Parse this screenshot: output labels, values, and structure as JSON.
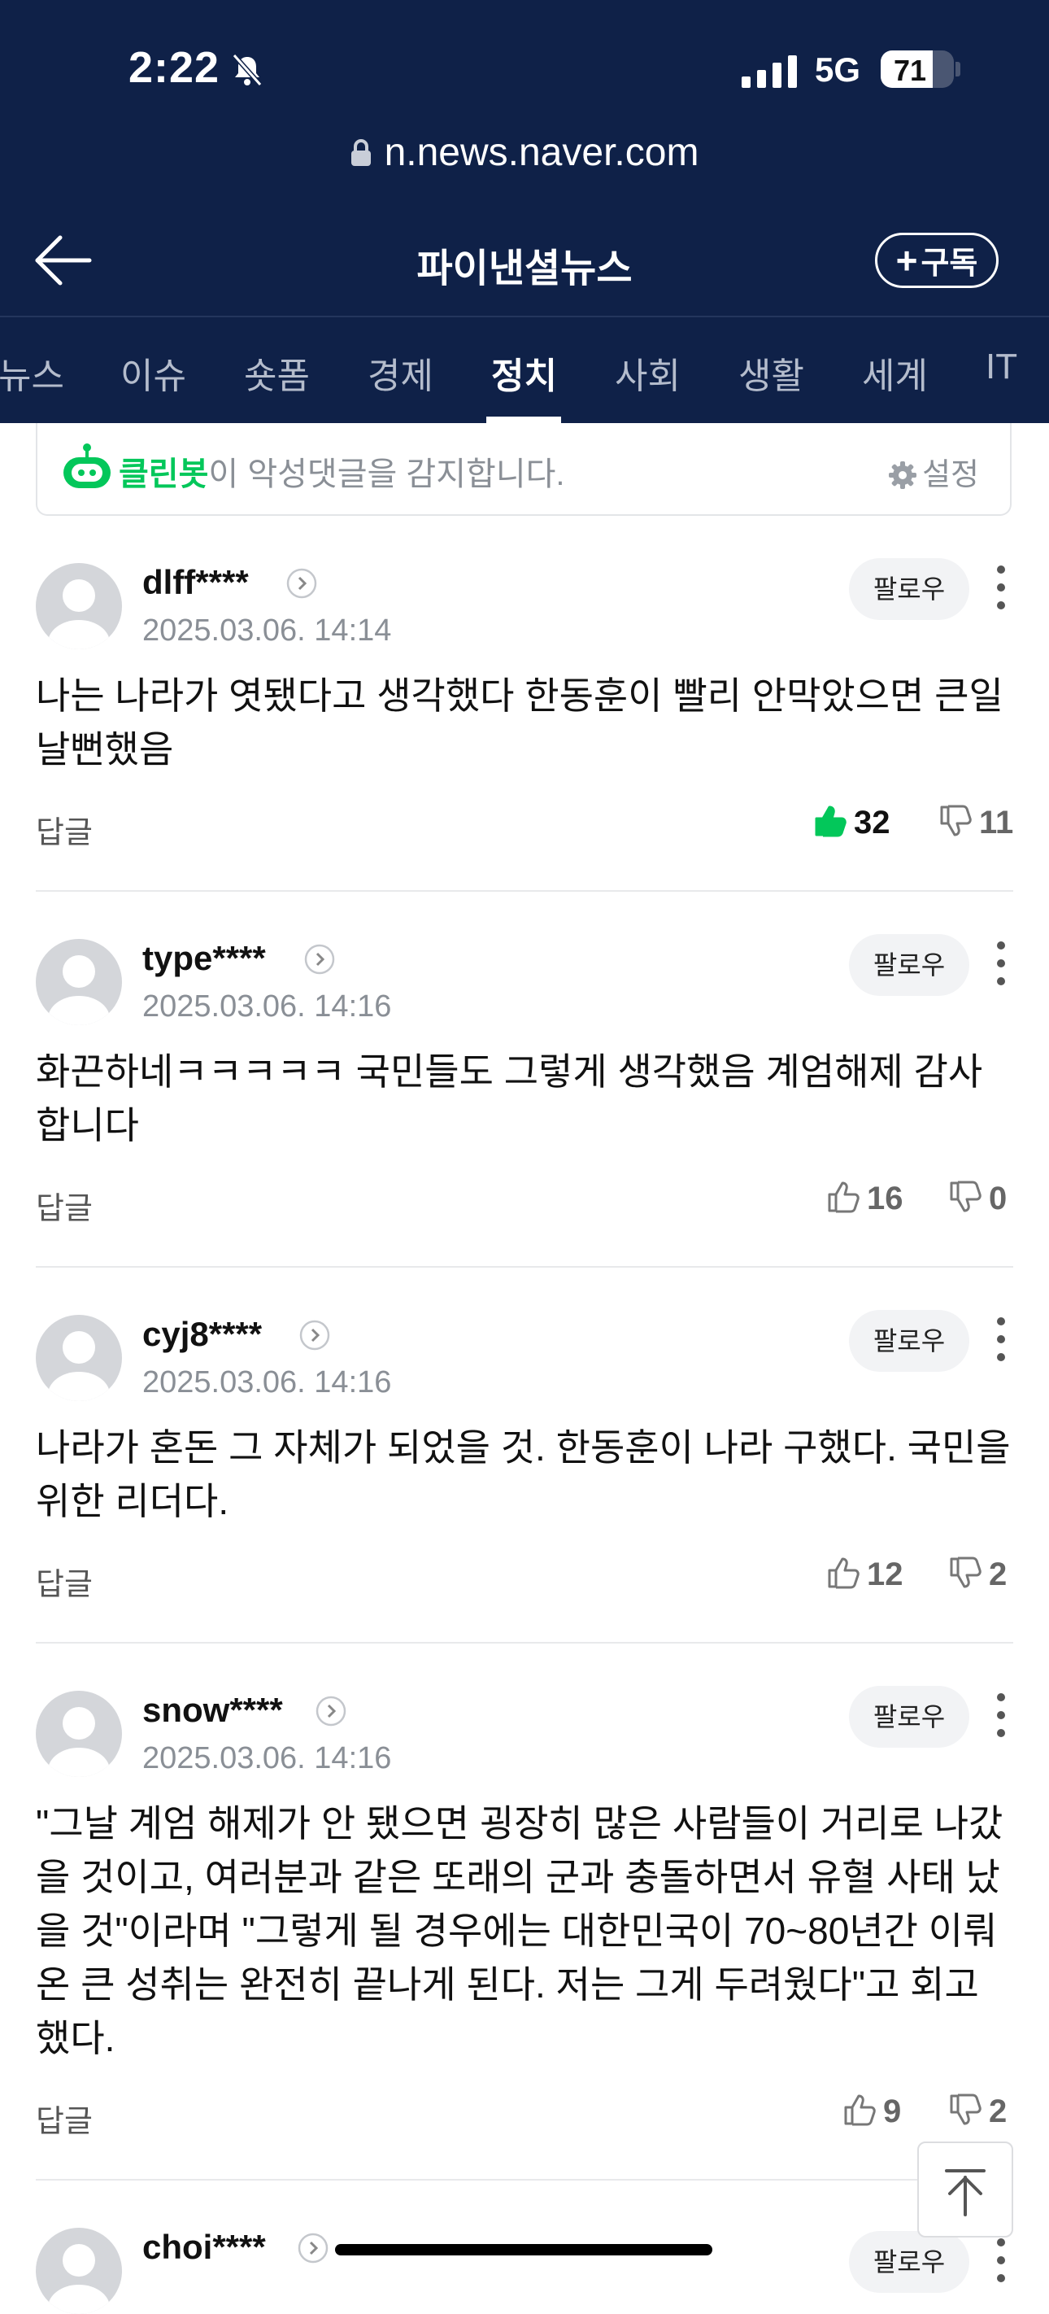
{
  "status_bar": {
    "time": "2:22",
    "network": "5G",
    "battery": "71",
    "battery_level": 0.71
  },
  "browser": {
    "url": "n.news.naver.com"
  },
  "header": {
    "title": "파이낸셜뉴스",
    "subscribe_label": "구독"
  },
  "tabs": [
    {
      "label": "뉴스",
      "active": false
    },
    {
      "label": "이슈",
      "active": false
    },
    {
      "label": "숏폼",
      "active": false
    },
    {
      "label": "경제",
      "active": false
    },
    {
      "label": "정치",
      "active": true
    },
    {
      "label": "사회",
      "active": false
    },
    {
      "label": "생활",
      "active": false
    },
    {
      "label": "세계",
      "active": false
    },
    {
      "label": "IT",
      "active": false
    }
  ],
  "cleanbot": {
    "name": "클린봇",
    "message": "이 악성댓글을 감지합니다.",
    "settings_label": "설정"
  },
  "comments": [
    {
      "nick": "dlff****",
      "date": "2025.03.06. 14:14",
      "text": "나는 나라가 엿됐다고 생각했다 한동훈이 빨리 안막았으면 큰일날뻔했음",
      "likes": "32",
      "dislikes": "11",
      "liked": true,
      "follow": "팔로우",
      "reply": "답글"
    },
    {
      "nick": "type****",
      "date": "2025.03.06. 14:16",
      "text": "화끈하네ㅋㅋㅋㅋㅋ 국민들도 그렇게 생각했음 계엄해제 감사합니다",
      "likes": "16",
      "dislikes": "0",
      "liked": false,
      "follow": "팔로우",
      "reply": "답글"
    },
    {
      "nick": "cyj8****",
      "date": "2025.03.06. 14:16",
      "text": "나라가 혼돈 그 자체가 되었을 것. 한동훈이 나라 구했다. 국민을 위한 리더다.",
      "likes": "12",
      "dislikes": "2",
      "liked": false,
      "follow": "팔로우",
      "reply": "답글"
    },
    {
      "nick": "snow****",
      "date": "2025.03.06. 14:16",
      "text": "\"그날 계엄 해제가 안 됐으면 굉장히 많은 사람들이 거리로 나갔을 것이고, 여러분과 같은 또래의 군과 충돌하면서 유혈 사태 났을 것\"이라며 \"그렇게 될 경우에는 대한민국이 70~80년간 이뤄온 큰 성취는 완전히 끝나게 된다. 저는 그게 두려웠다\"고 회고했다.",
      "likes": "9",
      "dislikes": "2",
      "liked": false,
      "follow": "팔로우",
      "reply": "답글"
    },
    {
      "nick": "choi****",
      "follow": "팔로우"
    }
  ],
  "colors": {
    "header_bg": "#0f2148",
    "cleanbot_green": "#03c75a",
    "like_green": "#03c75a"
  }
}
